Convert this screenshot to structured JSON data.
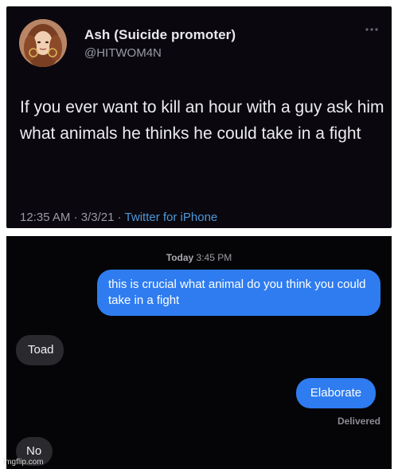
{
  "tweet": {
    "display_name": "Ash (Suicide promoter)",
    "handle": "@HITWOM4N",
    "text": "If you ever want to kill an hour with a guy ask him what animals he thinks he could take in a fight",
    "time": "12:35 AM",
    "date": "3/3/21",
    "separator": "·",
    "source": "Twitter for iPhone",
    "avatar_icon": "profile-photo",
    "more_icon": "more-dots-icon"
  },
  "chat": {
    "timestamp_day": "Today",
    "timestamp_time": "3:45 PM",
    "messages": [
      {
        "sender": "me",
        "text": "this is crucial what animal do you think you could take in a fight"
      },
      {
        "sender": "them",
        "text": "Toad"
      },
      {
        "sender": "me",
        "text": "Elaborate"
      },
      {
        "sender": "them",
        "text": "No"
      }
    ],
    "delivered_label": "Delivered"
  },
  "watermark": "imgflip.com",
  "colors": {
    "tweet_bg": "#0a080e",
    "chat_bg": "#050507",
    "sent_bubble": "#2f7cf0",
    "received_bubble": "#2a2a2e",
    "link_blue": "#4f97d8"
  }
}
